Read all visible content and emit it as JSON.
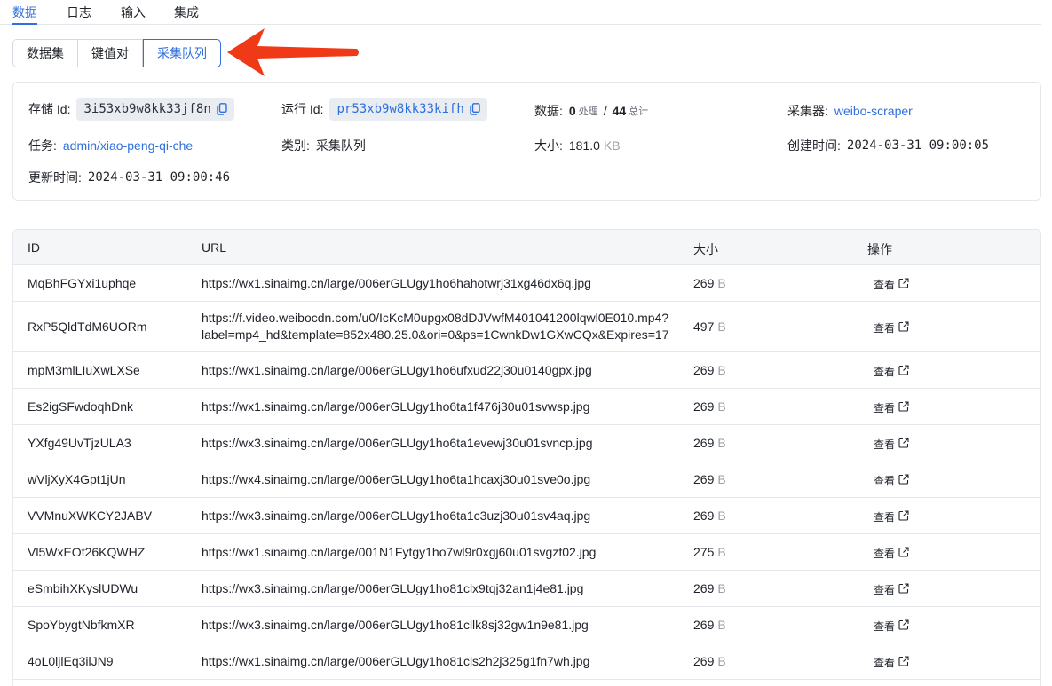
{
  "tabs": [
    {
      "label": "数据",
      "active": true
    },
    {
      "label": "日志",
      "active": false
    },
    {
      "label": "输入",
      "active": false
    },
    {
      "label": "集成",
      "active": false
    }
  ],
  "segments": [
    {
      "label": "数据集",
      "active": false
    },
    {
      "label": "键值对",
      "active": false
    },
    {
      "label": "采集队列",
      "active": true
    }
  ],
  "info": {
    "storage_label": "存储 Id:",
    "storage_id": "3i53xb9w8kk33jf8n",
    "run_label": "运行 Id:",
    "run_id": "pr53xb9w8kk33kifh",
    "data_label": "数据:",
    "data_processed": "0",
    "data_processed_unit": "处理",
    "data_sep": "/",
    "data_total": "44",
    "data_total_unit": "总计",
    "collector_label": "采集器:",
    "collector": "weibo-scraper",
    "task_label": "任务:",
    "task": "admin/xiao-peng-qi-che",
    "type_label": "类别:",
    "type": "采集队列",
    "size_label": "大小:",
    "size_value": "181.0",
    "size_unit": "KB",
    "created_label": "创建时间:",
    "created": "2024-03-31 09:00:05",
    "updated_label": "更新时间:",
    "updated": "2024-03-31 09:00:46"
  },
  "table": {
    "headers": {
      "id": "ID",
      "url": "URL",
      "size": "大小",
      "action": "操作"
    },
    "view_label": "查看",
    "size_unit": "B",
    "rows": [
      {
        "id": "MqBhFGYxi1uphqe",
        "url": "https://wx1.sinaimg.cn/large/006erGLUgy1ho6hahotwrj31xg46dx6q.jpg",
        "size": "269"
      },
      {
        "id": "RxP5QldTdM6UORm",
        "url": "https://f.video.weibocdn.com/u0/IcKcM0upgx08dDJVwfM401041200lqwl0E010.mp4?",
        "url2": "label=mp4_hd&template=852x480.25.0&ori=0&ps=1CwnkDw1GXwCQx&Expires=17",
        "size": "497"
      },
      {
        "id": "mpM3mlLIuXwLXSe",
        "url": "https://wx1.sinaimg.cn/large/006erGLUgy1ho6ufxud22j30u0140gpx.jpg",
        "size": "269"
      },
      {
        "id": "Es2igSFwdoqhDnk",
        "url": "https://wx1.sinaimg.cn/large/006erGLUgy1ho6ta1f476j30u01svwsp.jpg",
        "size": "269"
      },
      {
        "id": "YXfg49UvTjzULA3",
        "url": "https://wx3.sinaimg.cn/large/006erGLUgy1ho6ta1evewj30u01svncp.jpg",
        "size": "269"
      },
      {
        "id": "wVljXyX4Gpt1jUn",
        "url": "https://wx4.sinaimg.cn/large/006erGLUgy1ho6ta1hcaxj30u01sve0o.jpg",
        "size": "269"
      },
      {
        "id": "VVMnuXWKCY2JABV",
        "url": "https://wx3.sinaimg.cn/large/006erGLUgy1ho6ta1c3uzj30u01sv4aq.jpg",
        "size": "269"
      },
      {
        "id": "Vl5WxEOf26KQWHZ",
        "url": "https://wx1.sinaimg.cn/large/001N1Fytgy1ho7wl9r0xgj60u01svgzf02.jpg",
        "size": "275"
      },
      {
        "id": "eSmbihXKyslUDWu",
        "url": "https://wx3.sinaimg.cn/large/006erGLUgy1ho81clx9tqj32an1j4e81.jpg",
        "size": "269"
      },
      {
        "id": "SpoYbygtNbfkmXR",
        "url": "https://wx3.sinaimg.cn/large/006erGLUgy1ho81cllk8sj32gw1n9e81.jpg",
        "size": "269"
      },
      {
        "id": "4oL0ljlEq3ilJN9",
        "url": "https://wx1.sinaimg.cn/large/006erGLUgy1ho81cls2h2j325g1fn7wh.jpg",
        "size": "269"
      }
    ]
  },
  "colors": {
    "accent": "#2f6fde",
    "arrow": "#f03a17",
    "chip_bg": "#e9ecf1"
  }
}
